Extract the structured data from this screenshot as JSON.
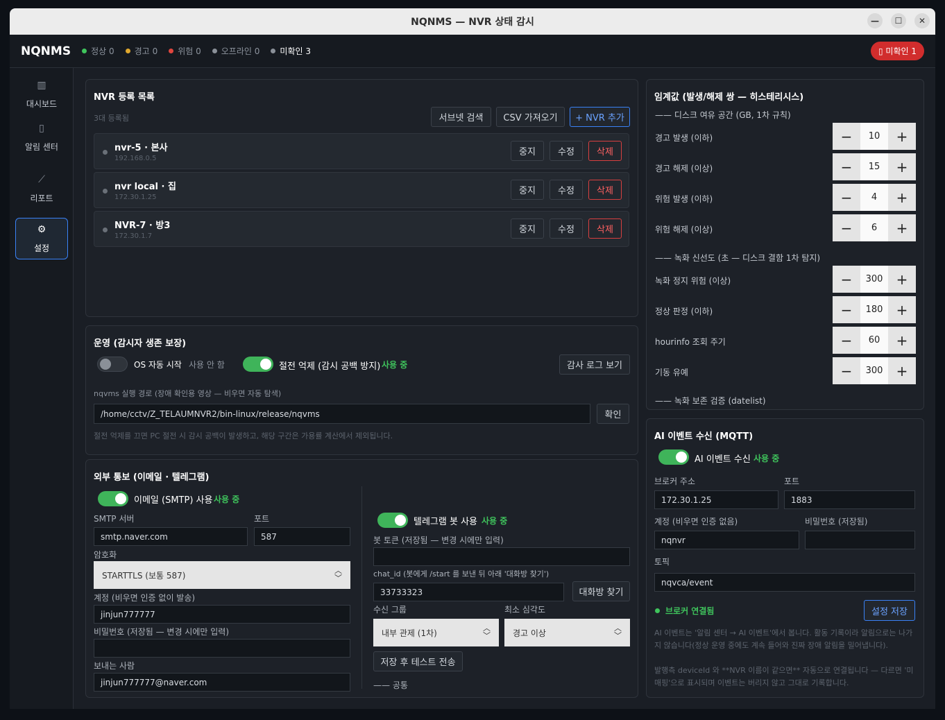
{
  "window": {
    "title": "NQNMS — NVR 상태 감시",
    "min": "—",
    "max": "☐",
    "close": "✕"
  },
  "topbar": {
    "brand": "NQNMS",
    "stats": [
      {
        "label": "정상",
        "count": "0",
        "color": "#3fc45c"
      },
      {
        "label": "경고",
        "count": "0",
        "color": "#e0a82e"
      },
      {
        "label": "위험",
        "count": "0",
        "color": "#e0463e"
      },
      {
        "label": "오프라인",
        "count": "0",
        "color": "#8a9098"
      },
      {
        "label": "미확인",
        "count": "3",
        "color": "#8a9098"
      }
    ],
    "unack_button": "▯ 미확인 1"
  },
  "sidebar": [
    {
      "label": "대시보드",
      "icon": "bar-chart-icon"
    },
    {
      "label": "알림 센터",
      "icon": "bell-icon"
    },
    {
      "label": "리포트",
      "icon": "line-chart-icon"
    },
    {
      "label": "설정",
      "icon": "gear-icon"
    }
  ],
  "nvr_list": {
    "title": "NVR 등록 목록",
    "count_text": "3대 등록됨",
    "subnet_search": "서브넷 검색",
    "csv_import": "CSV 가져오기",
    "add_nvr": "+ NVR 추가",
    "row_buttons": {
      "stop": "중지",
      "edit": "수정",
      "delete": "삭제"
    },
    "rows": [
      {
        "name": "nvr-5 · 본사",
        "ip": "192.168.0.5"
      },
      {
        "name": "nvr local · 집",
        "ip": "172.30.1.25"
      },
      {
        "name": "NVR-7 · 방3",
        "ip": "172.30.1.7"
      }
    ]
  },
  "operation": {
    "title": "운영 (감시자 생존 보장)",
    "autostart_label": "OS 자동 시작",
    "autostart_state": "사용 안 함",
    "nosleep_label": "절전 억제 (감시 공백 방지)",
    "nosleep_state": "사용 중",
    "audit_log": "감사 로그 보기",
    "path_label": "nqvms 실행 경로 (장애 확인용 영상 — 비우면 자동 탐색)",
    "path_value": "/home/cctv/Z_TELAUMNVR2/bin-linux/release/nqvms",
    "confirm": "확인",
    "note": "절전 억제를 끄면 PC 절전 시 감시 공백이 발생하고, 해당 구간은 가용률 계산에서 제외됩니다."
  },
  "notify": {
    "title": "외부 통보 (이메일 · 텔레그램)",
    "email_label": "이메일 (SMTP) 사용",
    "email_state": "사용 중",
    "smtp_label": "SMTP 서버",
    "smtp_value": "smtp.naver.com",
    "port_label": "포트",
    "port_value": "587",
    "enc_label": "암호화",
    "enc_value": "STARTTLS (보통 587)",
    "account_label": "계정 (비우면 인증 없이 발송)",
    "account_value": "jinjun777777",
    "pw_label": "비밀번호 (저장됨 — 변경 시에만 입력)",
    "pw_value": "",
    "sender_label": "보내는 사람",
    "sender_value": "jinjun777777@naver.com",
    "tg_label": "텔레그램 봇 사용",
    "tg_state": "사용 중",
    "token_label": "봇 토큰 (저장됨 — 변경 시에만 입력)",
    "token_value": "",
    "chatid_label": "chat_id (봇에게 /start 를 보낸 뒤 아래 '대화방 찾기')",
    "chatid_value": "33733323",
    "find_chat": "대화방 찾기",
    "group_label": "수신 그룹",
    "group_value": "내부 관제 (1차)",
    "severity_label": "최소 심각도",
    "severity_value": "경고 이상",
    "save_test": "저장 후 테스트 전송",
    "common": "—— 공통"
  },
  "thresholds": {
    "title": "임계값 (발생/해제 쌍 — 히스테리시스)",
    "disk_section": "—— 디스크 여유 공간 (GB, 1차 규칙)",
    "rec_section": "—— 녹화 신선도 (초 — 디스크 결함 1차 탐지)",
    "cut_section": "—— 녹화 보존 검증 (datelist)",
    "items": [
      {
        "label": "경고 발생 (이하)",
        "value": "10"
      },
      {
        "label": "경고 해제 (이상)",
        "value": "15"
      },
      {
        "label": "위험 발생 (이하)",
        "value": "4"
      },
      {
        "label": "위험 해제 (이상)",
        "value": "6"
      },
      {
        "label": "녹화 정지 위험 (이상)",
        "value": "300"
      },
      {
        "label": "정상 판정 (이하)",
        "value": "180"
      },
      {
        "label": "hourinfo 조회 주기",
        "value": "60"
      },
      {
        "label": "기동 유예",
        "value": "300"
      }
    ],
    "minus": "−",
    "plus": "+"
  },
  "mqtt": {
    "title": "AI 이벤트 수신 (MQTT)",
    "toggle_label": "AI 이벤트 수신",
    "toggle_state": "사용 중",
    "broker_label": "브로커 주소",
    "broker_value": "172.30.1.25",
    "port_label": "포트",
    "port_value": "1883",
    "account_label": "계정 (비우면 인증 없음)",
    "account_value": "nqnvr",
    "pw_label": "비밀번호 (저장됨)",
    "pw_value": "",
    "topic_label": "토픽",
    "topic_value": "nqvca/event",
    "status": "브로커 연결됨",
    "save": "설정 저장",
    "note1": "AI 이벤트는 '알림 센터 → AI 이벤트'에서 봅니다. 활동 기록이라 알림으로는 나가지 않습니다(정상 운영 중에도 계속 들어와 진짜 장애 알림을 밀어냅니다).",
    "note2": "발행측 deviceId 와 **NVR 이름이 같으면** 자동으로 연결됩니다 — 다르면 '미매핑'으로 표시되며 이벤트는 버리지 않고 그대로 기록합니다."
  }
}
